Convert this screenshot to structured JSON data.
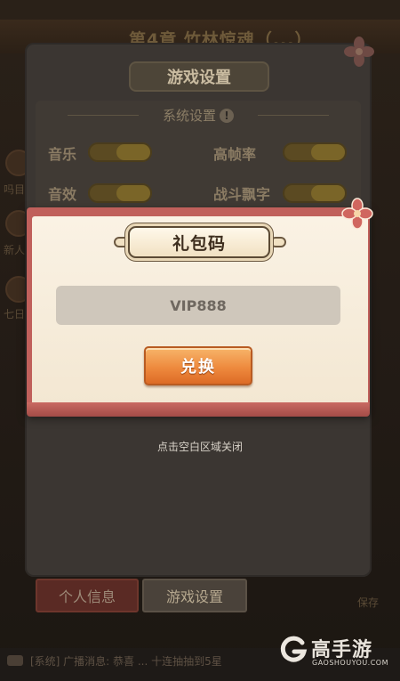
{
  "scene": {
    "chapter_title": "第4章 竹林惊魂（...）",
    "left_labels": [
      "吗目",
      "新人",
      "七日"
    ],
    "right_label": "保存"
  },
  "settings": {
    "title": "游戏设置",
    "section_heading": "系统设置",
    "info_badge": "!",
    "options": [
      {
        "label": "音乐",
        "on": true
      },
      {
        "label": "高帧率",
        "on": true
      },
      {
        "label": "音效",
        "on": true
      },
      {
        "label": "战斗飘字",
        "on": true
      }
    ]
  },
  "gift_dialog": {
    "title": "礼包码",
    "code_value": "VIP888",
    "redeem_label": "兑换"
  },
  "hint": "点击空白区域关闭",
  "tabs": [
    {
      "label": "个人信息",
      "active": false
    },
    {
      "label": "游戏设置",
      "active": true
    }
  ],
  "chat": {
    "text": "[系统] 广播消息: 恭喜 ... 十连抽抽到5星"
  },
  "watermark": {
    "brand": "高手游",
    "domain": "GAOSHOUYOU.COM"
  },
  "colors": {
    "dialog_frame": "#c0605b",
    "dialog_paper": "#faf2e4",
    "redeem_button": "#ee8a3e",
    "toggle_on": "#7a6528"
  },
  "icons": [
    "close-flower-icon",
    "info-icon",
    "chat-icon",
    "brand-logo-icon"
  ]
}
